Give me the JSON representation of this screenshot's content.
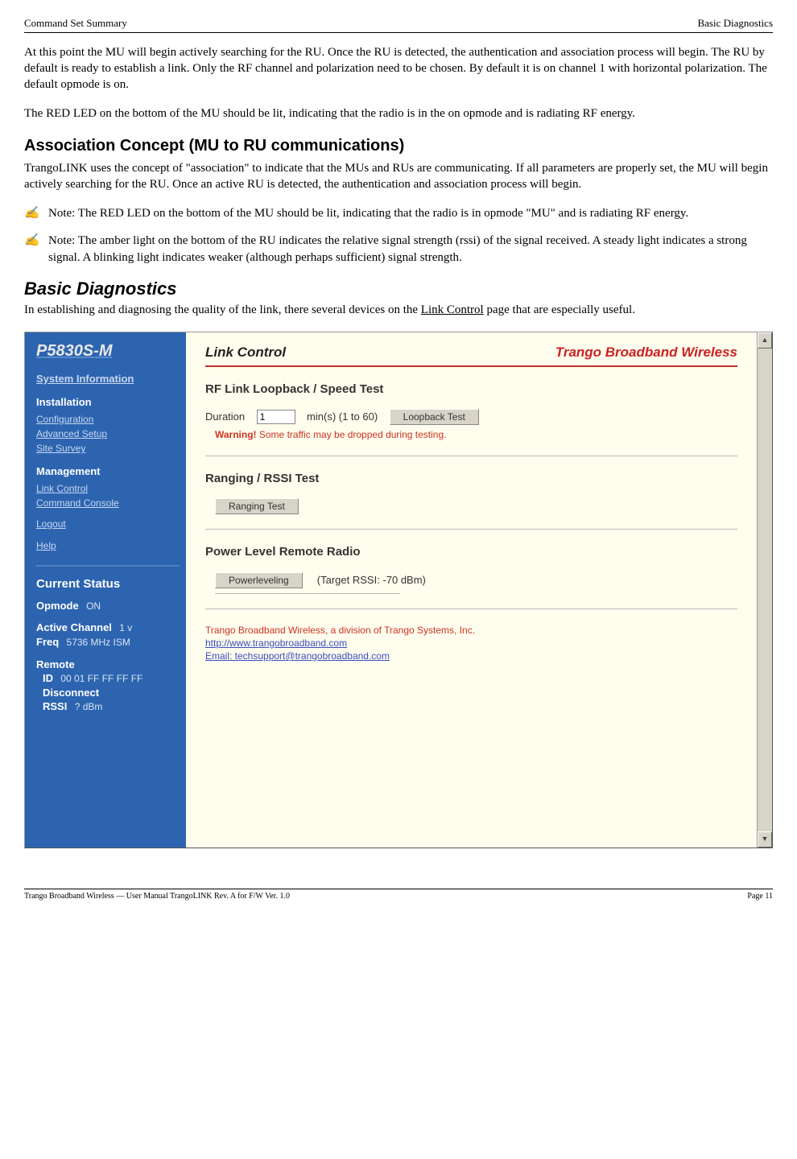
{
  "header": {
    "left": "Command Set Summary",
    "right": "Basic Diagnostics"
  },
  "body": {
    "p1": "At this point the MU will begin actively searching for the RU.  Once the RU is detected, the authentication and association process will begin.  The RU by default is ready to establish a link.  Only the RF channel and polarization need to be chosen.  By default it is on channel 1 with horizontal polarization.  The default opmode is on.",
    "p2": "The RED LED on the bottom of the MU should be lit, indicating that the radio is in the on opmode and is radiating RF energy.",
    "h1": "Association Concept (MU to RU communications)",
    "p3": "TrangoLINK uses the concept of \"association\" to indicate that the MUs and RUs are communicating.  If all parameters are properly set, the MU will begin actively searching for the RU.  Once an active RU is detected, the authentication and association process will begin.",
    "note1": "Note:  The RED LED on the bottom of the MU should be lit, indicating that the radio is in opmode \"MU\" and is radiating RF energy.",
    "note2": "Note:  The amber light on the bottom of the RU indicates the relative signal strength (rssi) of the signal received.  A steady light indicates a strong signal.  A blinking light indicates weaker (although perhaps sufficient) signal strength.",
    "h2": "Basic Diagnostics",
    "p4a": "In establishing and diagnosing the quality of the link, there several devices on the ",
    "p4b": "Link Control",
    "p4c": " page that are especially useful."
  },
  "sidebar": {
    "brand": "P5830S-M",
    "sysinfo": "System Information",
    "install": "Installation",
    "config": "Configuration",
    "advsetup": "Advanced Setup",
    "sitesurvey": "Site Survey",
    "management": "Management",
    "linkcontrol": "Link Control",
    "cmdconsole": "Command Console",
    "logout": "Logout",
    "help": "Help",
    "current_status": "Current Status",
    "opmode_lbl": "Opmode",
    "opmode_val": "ON",
    "active_ch_lbl": "Active Channel",
    "active_ch_val": "1 v",
    "freq_lbl": "Freq",
    "freq_val": "5736 MHz  ISM",
    "remote_lbl": "Remote",
    "id_lbl": "ID",
    "id_val": "00 01 FF FF FF FF",
    "disconnect": "Disconnect",
    "rssi_lbl": "RSSI",
    "rssi_val": "? dBm"
  },
  "main": {
    "title": "Link Control",
    "brand": "Trango Broadband Wireless",
    "sec1": "RF Link Loopback / Speed Test",
    "duration_lbl": "Duration",
    "duration_val": "1",
    "duration_units": "min(s)   (1 to 60)",
    "loopback_btn": "Loopback Test",
    "warn_b": "Warning!",
    "warn_t": " Some traffic may be dropped during testing.",
    "sec2": "Ranging / RSSI Test",
    "ranging_btn": "Ranging Test",
    "sec3": "Power Level Remote Radio",
    "power_btn": "Powerleveling",
    "target": "(Target RSSI: -70 dBm)",
    "company": "Trango Broadband Wireless, a division of Trango Systems, Inc.",
    "link1": "http://www.trangobroadband.com",
    "link2": "Email: techsupport@trangobroadband.com"
  },
  "footer": {
    "left": "Trango Broadband Wireless — User Manual TrangoLINK  Rev. A  for F/W Ver. 1.0",
    "right": "Page 11"
  }
}
